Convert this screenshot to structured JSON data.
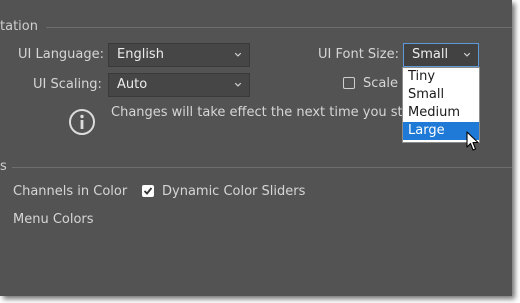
{
  "section_top": {
    "label": "tation"
  },
  "language": {
    "label": "UI Language:",
    "value": "English"
  },
  "font_size": {
    "label": "UI Font Size:",
    "value": "Small"
  },
  "scaling": {
    "label": "UI Scaling:",
    "value": "Auto"
  },
  "scale_ui": {
    "label": "Scale U",
    "checked": false
  },
  "notice": {
    "text": "Changes will take effect the next time you start P",
    "icon": "info-icon"
  },
  "font_size_options": [
    "Tiny",
    "Small",
    "Medium",
    "Large"
  ],
  "font_size_highlighted": "Large",
  "section_bottom": {
    "label": "s"
  },
  "options": {
    "channels_color": "Channels in Color",
    "dynamic_sliders": {
      "label": "Dynamic Color Sliders",
      "checked": true
    },
    "menu_colors": "Menu Colors"
  },
  "colors": {
    "panel_bg": "#535353",
    "accent": "#1e7ad6"
  }
}
